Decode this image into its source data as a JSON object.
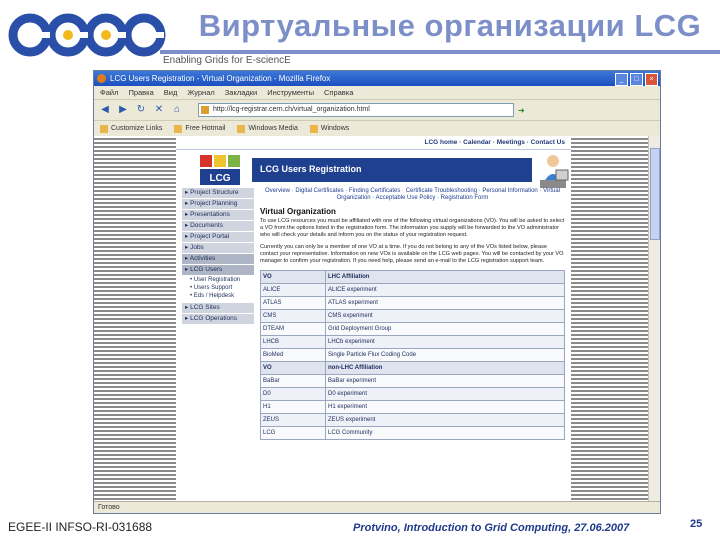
{
  "slide": {
    "title": "Виртуальные организации LCG",
    "logo_text": "egee",
    "tagline": "Enabling Grids for E-sciencE",
    "footer_left": "EGEE-II INFSO-RI-031688",
    "footer_center": "Protvino, Introduction to Grid Computing, 27.06.2007",
    "page_number": "25",
    "accent_color": "#7c8fc9"
  },
  "browser": {
    "window_title": "LCG Users Registration - Virtual Organization - Mozilla Firefox",
    "menu": [
      "Файл",
      "Правка",
      "Вид",
      "Журнал",
      "Закладки",
      "Инструменты",
      "Справка"
    ],
    "url": "http://lcg-registrar.cern.ch/virtual_organization.html",
    "bookmarks": [
      "Customize Links",
      "Free Hotmail",
      "Windows Media",
      "Windows"
    ],
    "status": "Готово"
  },
  "page": {
    "top_links": "LCG home · Calendar · Meetings · Contact Us",
    "banner_title": "LCG Users Registration",
    "lcg_logo_text": "LCG",
    "sidebar": [
      {
        "label": "Project Structure",
        "dark": false
      },
      {
        "label": "Project Planning",
        "dark": false
      },
      {
        "label": "Presentations",
        "dark": false
      },
      {
        "label": "Documents",
        "dark": false
      },
      {
        "label": "Project Portal",
        "dark": false
      },
      {
        "label": "Jobs",
        "dark": false
      },
      {
        "label": "Activities",
        "dark": true
      },
      {
        "label": "LCG Users",
        "dark": true
      }
    ],
    "sidebar_sub": [
      "User Registration",
      "Users Support",
      "Eds / Helpdesk"
    ],
    "sidebar_bottom": [
      "LCG Sites",
      "LCG Operations"
    ],
    "subnav": "Overview · Digital Certificates · Finding Certificates · Certificate Troubleshooting · Personal Information · Virtual Organization · Acceptable Use Policy · Registration Form",
    "heading": "Virtual Organization",
    "para1": "To use LCG resources you must be affiliated with one of the following virtual organizations (VO). You will be asked to select a VO from the options listed in the registration form. The information you supply will be forwarded to the VO administrator who will check your details and inform you on the status of your registration request.",
    "para2": "Currently you can only be a member of one VO at a time. If you do not belong to any of the VOs listed below, please contact your representative. Information on new VOs is available on the LCG web pages. You will be contacted by your VO manager to confirm your registration. If you need help, please send an e-mail to the LCG registration support team.",
    "table": [
      [
        "VO",
        "LHC Affiliation"
      ],
      [
        "ALICE",
        "ALICE experiment"
      ],
      [
        "ATLAS",
        "ATLAS experiment"
      ],
      [
        "CMS",
        "CMS experiment"
      ],
      [
        "DTEAM",
        "Grid Deployment Group"
      ],
      [
        "LHCB",
        "LHCb experiment"
      ],
      [
        "BioMed",
        "Single Particle Flux Coding Code"
      ],
      [
        "VO",
        "non-LHC Affiliation"
      ],
      [
        "BaBar",
        "BaBar experiment"
      ],
      [
        "D0",
        "D0 experiment"
      ],
      [
        "H1",
        "H1 experiment"
      ],
      [
        "ZEUS",
        "ZEUS experiment"
      ],
      [
        "LCG",
        "LCG Community"
      ]
    ]
  }
}
